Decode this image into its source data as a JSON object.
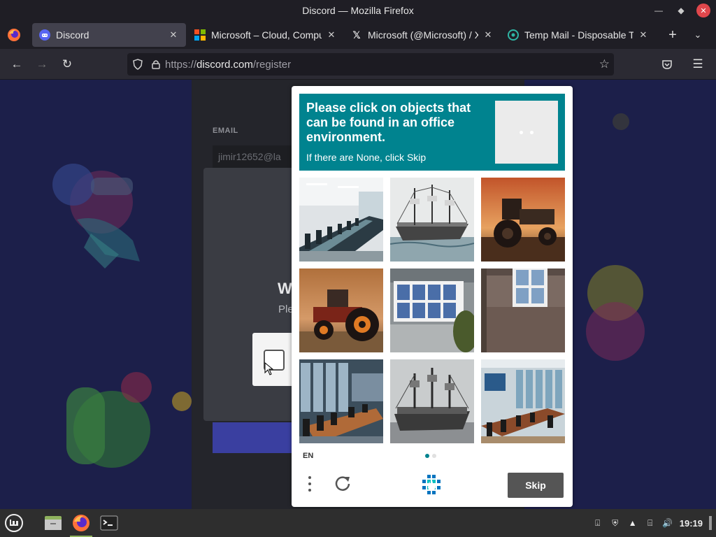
{
  "window": {
    "title": "Discord — Mozilla Firefox"
  },
  "tabs": [
    {
      "title": "Discord",
      "active": true,
      "icon": "discord-icon"
    },
    {
      "title": "Microsoft – Cloud, Compute",
      "active": false,
      "icon": "microsoft-icon"
    },
    {
      "title": "Microsoft (@Microsoft) / X",
      "active": false,
      "icon": "x-icon"
    },
    {
      "title": "Temp Mail - Disposable Tem",
      "active": false,
      "icon": "tempmail-icon"
    }
  ],
  "url": {
    "scheme": "https://",
    "host": "discord.com",
    "path": "/register"
  },
  "page": {
    "email_label": "EMAIL",
    "email_value": "jimir12652@la",
    "modal_title_partial": "W",
    "modal_sub_partial": "Ple"
  },
  "captcha": {
    "prompt": "Please click on objects that can be found in an office environment.",
    "sub": "If there are None, click Skip",
    "language": "EN",
    "skip_label": "Skip",
    "tiles": [
      {
        "name": "tile-conference-room-1",
        "subject": "conference room"
      },
      {
        "name": "tile-sailing-ship-1",
        "subject": "ship"
      },
      {
        "name": "tile-tractor-1",
        "subject": "tractor"
      },
      {
        "name": "tile-tractor-2",
        "subject": "tractor"
      },
      {
        "name": "tile-window-1",
        "subject": "window"
      },
      {
        "name": "tile-window-2",
        "subject": "window"
      },
      {
        "name": "tile-conference-room-2",
        "subject": "conference room"
      },
      {
        "name": "tile-sailing-ship-2",
        "subject": "ship"
      },
      {
        "name": "tile-conference-room-3",
        "subject": "conference room"
      }
    ],
    "colors": {
      "header": "#00838f",
      "skip": "#555555"
    }
  },
  "taskbar": {
    "clock": "19:19"
  }
}
